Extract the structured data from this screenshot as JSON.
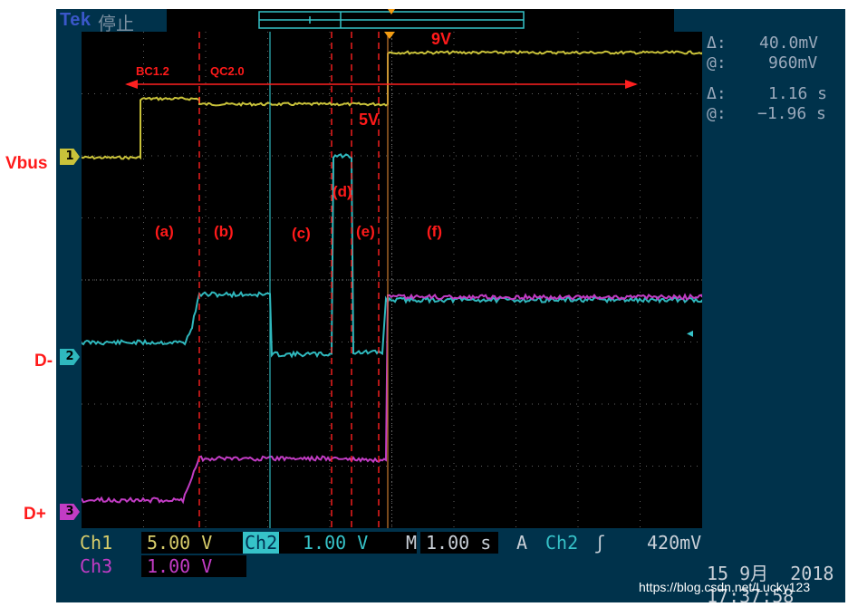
{
  "header": {
    "brand": "Tek",
    "run_status": "停止"
  },
  "channels": {
    "ch1": {
      "name": "Ch1",
      "scale": "5.00 V",
      "color": "#c9c23a",
      "marker": "1"
    },
    "ch2": {
      "name": "Ch2",
      "scale": "1.00 V",
      "color": "#2fb8bd",
      "marker": "2"
    },
    "ch3": {
      "name": "Ch3",
      "scale": "1.00 V",
      "color": "#c23cc4",
      "marker": "3"
    }
  },
  "timebase": {
    "label": "M",
    "value": "1.00 s"
  },
  "trigger": {
    "label": "A",
    "source": "Ch2",
    "slope_icon": "rising-edge-icon",
    "level": "420mV"
  },
  "cursors": {
    "delta_v_symbol": "Δ:",
    "delta_v": "40.0mV",
    "at_v_symbol": "@:",
    "at_v": "960mV",
    "delta_t_symbol": "Δ:",
    "delta_t": "1.16 s",
    "at_t_symbol": "@:",
    "at_t": "−1.96 s"
  },
  "datetime": {
    "date": "15 9月  2018",
    "time": "17:37:58"
  },
  "watermark": "https://blog.csdn.net/Lucky123",
  "annotations": {
    "vbus": "Vbus",
    "dminus": "D-",
    "dplus": "D+",
    "bc12": "BC1.2",
    "qc20": "QC2.0",
    "v5": "5V",
    "v9": "9V",
    "a": "(a)",
    "b": "(b)",
    "c": "(c)",
    "d": "(d)",
    "e": "(e)",
    "f": "(f)"
  },
  "colors": {
    "accent_red": "#ff1a1a",
    "screen_bg": "#000000",
    "frame_bg": "#00324b"
  }
}
